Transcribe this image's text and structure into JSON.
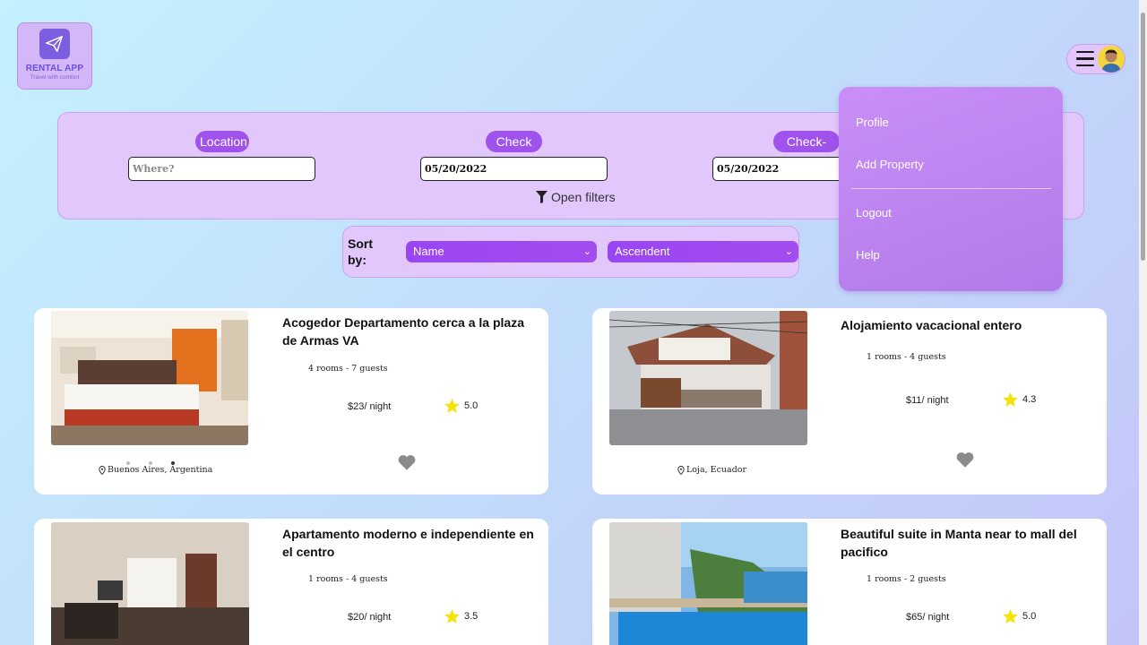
{
  "logo": {
    "title": "RENTAL APP",
    "subtitle": "Travel with comfort"
  },
  "search": {
    "location_label": "Location",
    "location_placeholder": "Where?",
    "checkin_label": "Check in",
    "checkin_value": "05/20/2022",
    "checkout_label": "Check-Out",
    "checkout_value": "05/20/2022",
    "open_filters": "Open filters"
  },
  "sort": {
    "label": "Sort by:",
    "field_value": "Name",
    "order_value": "Ascendent"
  },
  "menu": {
    "items": [
      "Profile",
      "Add Property",
      "Logout",
      "Help"
    ]
  },
  "listings": [
    {
      "title": "Acogedor Departamento cerca a la plaza de Armas VA",
      "rooms": "4 rooms - 7 guests",
      "price": "$23/ night",
      "rating": "5.0",
      "location": "Buenos Aires, Argentina"
    },
    {
      "title": "Alojamiento vacacional entero",
      "rooms": "1 rooms - 4 guests",
      "price": "$11/ night",
      "rating": "4.3",
      "location": "Loja, Ecuador"
    },
    {
      "title": "Apartamento moderno e independiente en el centro",
      "rooms": "1 rooms - 4 guests",
      "price": "$20/ night",
      "rating": "3.5",
      "location": ""
    },
    {
      "title": "Beautiful suite in Manta near to mall del pacifico",
      "rooms": "1 rooms - 2 guests",
      "price": "$65/ night",
      "rating": "5.0",
      "location": ""
    }
  ],
  "colors": {
    "accent": "#9f52ec",
    "menu_bg": "#c98ef7",
    "panel_bg": "#e1c7fb",
    "star": "#f5e20a"
  }
}
